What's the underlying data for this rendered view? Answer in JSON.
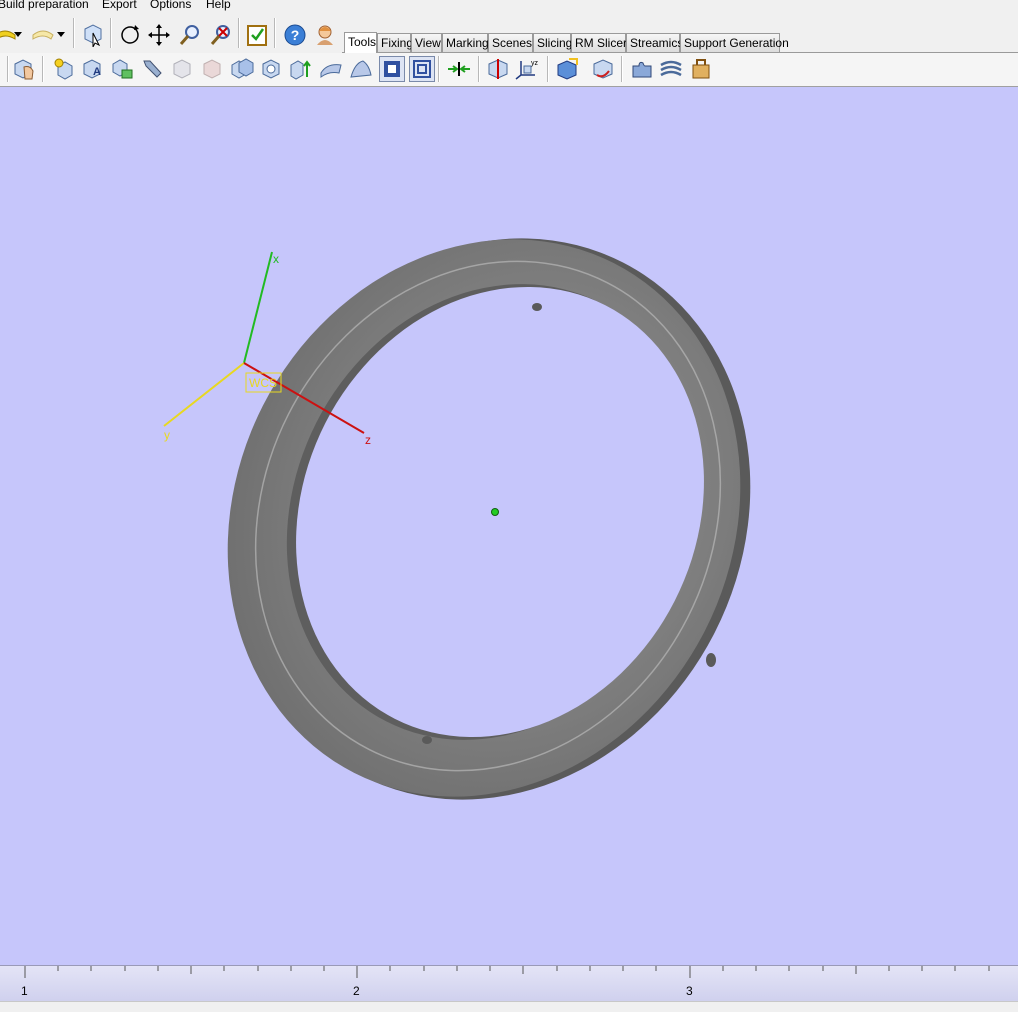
{
  "menu": {
    "items": [
      "Build preparation",
      "Export",
      "Options",
      "Help"
    ]
  },
  "tabs": [
    "Tools",
    "Fixing",
    "View",
    "Marking",
    "Scenes",
    "Slicing",
    "RM Slicer",
    "Streamics",
    "Support Generation"
  ],
  "active_tab": "Tools",
  "toolbar1": {
    "icons": [
      "undo-icon",
      "undo-dropdown-icon",
      "redo-icon",
      "redo-dropdown-icon",
      "select-part-icon",
      "rotate-icon",
      "pan-icon",
      "zoom-icon",
      "zoom-fit-icon",
      "checklist-icon",
      "help-icon",
      "assistant-icon"
    ]
  },
  "toolbar2": {
    "icons": [
      "part-hand-icon",
      "new-part-icon",
      "part-a-icon",
      "part-group-icon",
      "probe-icon",
      "part-disabled-icon",
      "part-disabled2-icon",
      "copy-part-icon",
      "hollow-icon",
      "extrude-icon",
      "surface-icon",
      "wrap-icon",
      "offset-icon",
      "contour-icon",
      "align-icon",
      "cut-icon",
      "axis-icon",
      "box-icon",
      "transform-icon",
      "puzzle-icon",
      "layers-icon",
      "package-icon"
    ]
  },
  "viewport": {
    "background": "#c6c6fb",
    "wcs_label": "WCS",
    "axis_labels": {
      "x": "x",
      "y": "y",
      "z": "z"
    },
    "axis_colors": {
      "x": "#22bb22",
      "y": "#e8d820",
      "z": "#cc1111"
    }
  },
  "ruler": {
    "labels": [
      "1",
      "2",
      "3"
    ]
  }
}
